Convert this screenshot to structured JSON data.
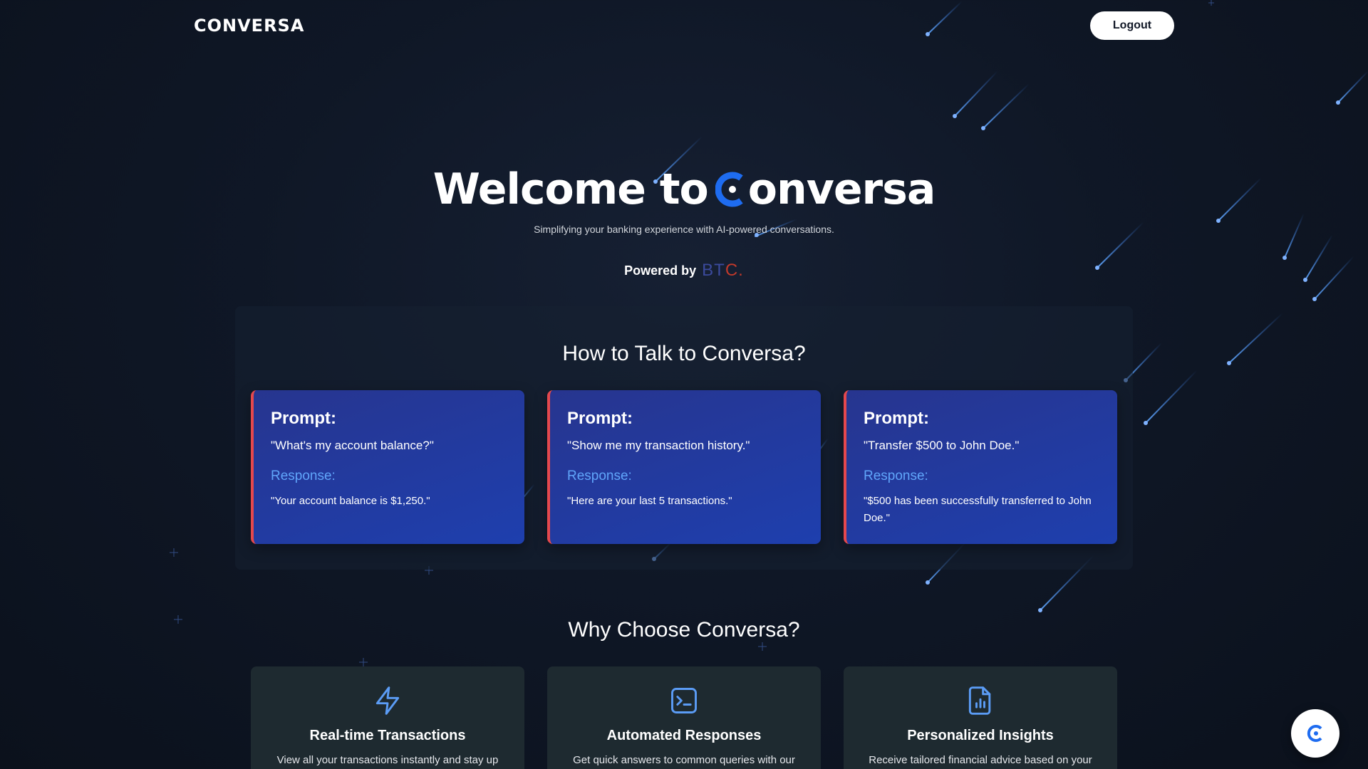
{
  "header": {
    "brand": "CONVERSA",
    "logout_label": "Logout"
  },
  "hero": {
    "title_part1": "Welcome to",
    "title_part2": "onversa",
    "subtitle": "Simplifying your banking experience with AI-powered conversations.",
    "powered_by": "Powered by",
    "partner_logo_text": "BTC."
  },
  "prompts_section": {
    "title": "How to Talk to Conversa?",
    "cards": [
      {
        "prompt_label": "Prompt:",
        "prompt": "\"What's my account balance?\"",
        "response_label": "Response:",
        "response": "\"Your account balance is $1,250.\""
      },
      {
        "prompt_label": "Prompt:",
        "prompt": "\"Show me my transaction history.\"",
        "response_label": "Response:",
        "response": "\"Here are your last 5 transactions.\""
      },
      {
        "prompt_label": "Prompt:",
        "prompt": "\"Transfer $500 to John Doe.\"",
        "response_label": "Response:",
        "response": "\"$500 has been successfully transferred to John Doe.\""
      }
    ]
  },
  "features_section": {
    "title": "Why Choose Conversa?",
    "cards": [
      {
        "icon": "lightning-icon",
        "title": "Real-time Transactions",
        "desc": "View all your transactions instantly and stay up"
      },
      {
        "icon": "terminal-icon",
        "title": "Automated Responses",
        "desc": "Get quick answers to common queries with our"
      },
      {
        "icon": "report-icon",
        "title": "Personalized Insights",
        "desc": "Receive tailored financial advice based on your"
      }
    ]
  },
  "chat_widget": {
    "icon": "conversa-logo-icon"
  },
  "colors": {
    "accent": "#1e6cf0",
    "card_border": "#e5484d",
    "response_label": "#60a5fa"
  }
}
